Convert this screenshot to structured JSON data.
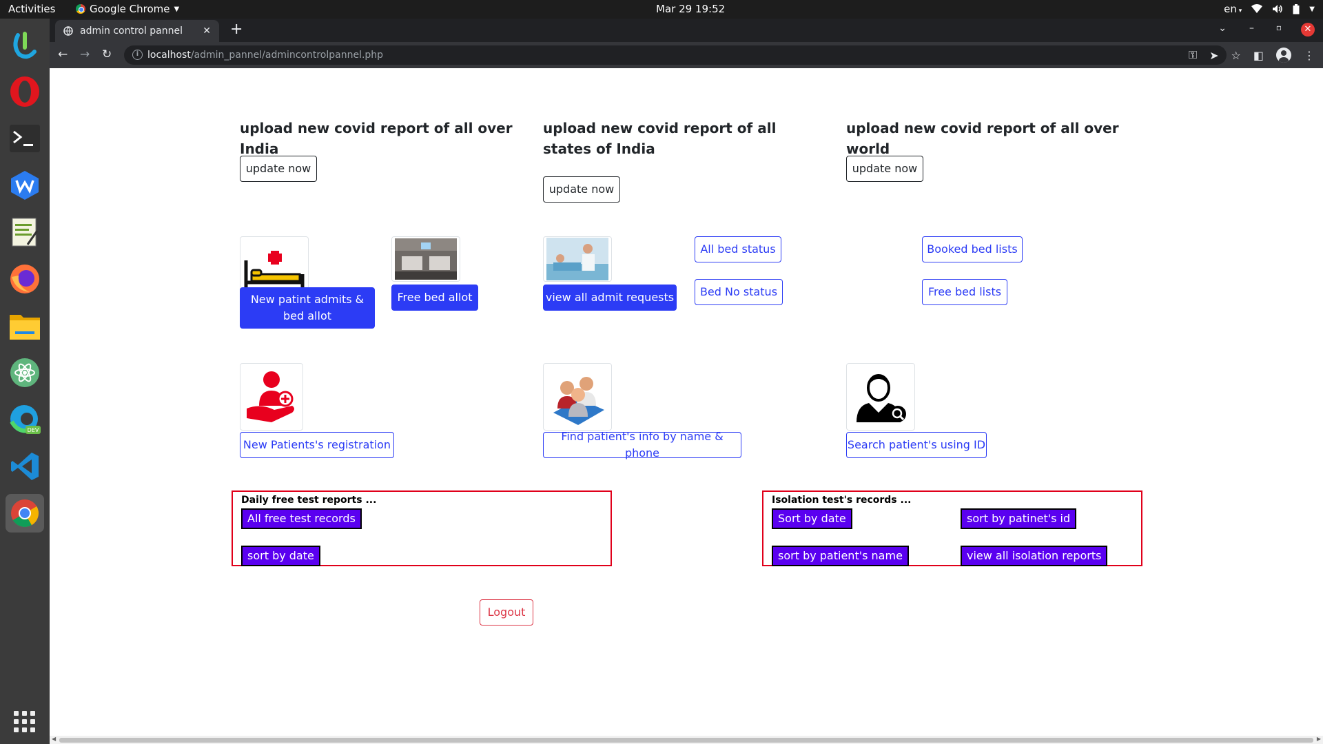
{
  "topbar": {
    "activities": "Activities",
    "app_name": "Google Chrome",
    "clock": "Mar 29  19:52",
    "lang": "en",
    "tray_icons": [
      "wifi-icon",
      "volume-icon",
      "battery-icon",
      "chevron-down-icon"
    ]
  },
  "dock": {
    "items": [
      "ubuntu-software-icon",
      "opera-icon",
      "terminal-icon",
      "wps-writer-icon",
      "text-editor-icon",
      "firefox-icon",
      "files-icon",
      "atom-icon",
      "edge-dev-icon",
      "vscode-icon",
      "chrome-icon"
    ],
    "edge_badge": "DEV"
  },
  "browser": {
    "tab_title": "admin control pannel",
    "url_host": "localhost",
    "url_path": "/admin_pannel/admincontrolpannel.php"
  },
  "page": {
    "sections": {
      "india": {
        "heading": "upload new covid report of all over India",
        "button": "update now"
      },
      "states": {
        "heading": "upload new covid report of all states of India",
        "button": "update now"
      },
      "world": {
        "heading": "upload new covid report of all over world",
        "button": "update now"
      }
    },
    "beds": {
      "new_admit": "New patint admits & bed allot",
      "free_bed_allot": "Free bed allot",
      "view_admit_requests": "view all admit requests",
      "all_bed_status": "All bed status",
      "bed_no_status": "Bed No status",
      "booked_bed_lists": "Booked bed lists",
      "free_bed_lists": "Free bed lists"
    },
    "patients": {
      "registration": "New Patients's registration",
      "find_info": "Find patient's info by name & phone",
      "search_id": "Search patient's using ID"
    },
    "daily_tests": {
      "title": "Daily free test reports ...",
      "all_records": "All free test records",
      "sort_date": "sort by date"
    },
    "isolation": {
      "title": "Isolation test's records ...",
      "sort_date": "Sort by date",
      "sort_id": "sort by patinet's id",
      "sort_name": "sort by patient's name",
      "view_all": "view all isolation reports"
    },
    "logout": "Logout"
  },
  "colors": {
    "primary_blue": "#2c3cf5",
    "purple": "#5a00f0",
    "red_border": "#e0001a",
    "logout_red": "#dc3545"
  }
}
